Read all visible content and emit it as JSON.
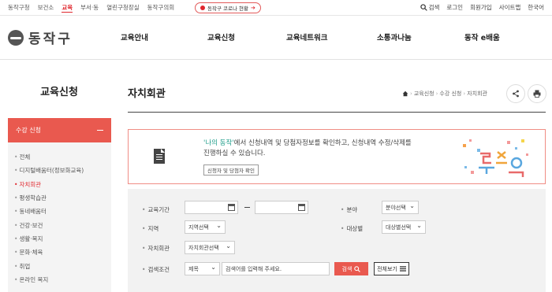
{
  "topbar": {
    "links": [
      "동작구청",
      "보건소",
      "교육",
      "부서·동",
      "열린구청장실",
      "동작구의회"
    ],
    "active_index": 2,
    "corona_label": "동작구 코로나 현황",
    "search_label": "검색",
    "login": "로그인",
    "join": "회원가입",
    "sitemap": "사이트맵",
    "language": "한국어"
  },
  "header": {
    "logo_text": "동작구",
    "gnb": [
      "교육안내",
      "교육신청",
      "교육네트워크",
      "소통과나눔",
      "동작 e배움"
    ]
  },
  "lnb": {
    "title": "교육신청",
    "section": "수강 신청",
    "items": [
      "전체",
      "디지털배움터(정보화교육)",
      "자치회관",
      "평생학습관",
      "동네배움터",
      "건강·보건",
      "생활·복지",
      "문화·체육",
      "취업",
      "온라인 복지"
    ],
    "active_index": 2
  },
  "content": {
    "title": "자치회관",
    "breadcrumb": [
      "교육신청",
      "수강 신청",
      "자치회관"
    ]
  },
  "notice": {
    "highlight": "'나의 동작'",
    "text_after": "에서 신청내역 및 당첨자정보를 확인하고, 신청내역 수정/삭제를",
    "text_line2": "진행하실 수 있습니다.",
    "button": "신청자 및 당첨자 확인"
  },
  "search": {
    "period_label": "교육기간",
    "field_label": "분야",
    "field_value": "분야선택",
    "region_label": "지역",
    "region_value": "지역선택",
    "target_label": "대상별",
    "target_value": "대상별선택",
    "center_label": "자치회관",
    "center_value": "자치회관선택",
    "keyword_label": "검색조건",
    "keyword_type": "제목",
    "keyword_placeholder": "검색어를 입력해 주세요.",
    "search_button": "검색",
    "view_all_button": "전체보기"
  },
  "colors": {
    "accent": "#e9594f",
    "teal": "#1f9d8a"
  }
}
